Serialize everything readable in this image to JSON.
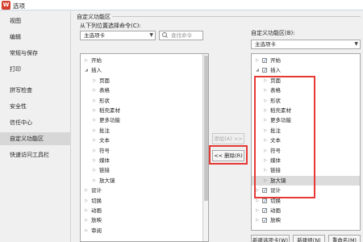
{
  "window": {
    "title": "选项",
    "logo_text": "W"
  },
  "sidebar": {
    "items": [
      {
        "label": "视图"
      },
      {
        "label": "编辑"
      },
      {
        "label": "常规与保存"
      },
      {
        "label": "打印"
      },
      {
        "label": "拼写检查"
      },
      {
        "label": "安全性"
      },
      {
        "label": "信任中心"
      },
      {
        "label": "自定义功能区",
        "active": true
      },
      {
        "label": "快速访问工具栏"
      }
    ]
  },
  "main": {
    "section_title": "自定义功能区",
    "left": {
      "label": "从下列位置选择命令(C):",
      "dropdown": "主选项卡",
      "search_placeholder": "查找命令",
      "items": [
        {
          "label": "开始",
          "level": 0,
          "expanded": false
        },
        {
          "label": "插入",
          "level": 0,
          "expanded": true
        },
        {
          "label": "页面",
          "level": 1
        },
        {
          "label": "表格",
          "level": 1
        },
        {
          "label": "形状",
          "level": 1
        },
        {
          "label": "稻壳素材",
          "level": 1
        },
        {
          "label": "更多功能",
          "level": 1
        },
        {
          "label": "批注",
          "level": 1
        },
        {
          "label": "文本",
          "level": 1
        },
        {
          "label": "符号",
          "level": 1
        },
        {
          "label": "媒体",
          "level": 1
        },
        {
          "label": "链接",
          "level": 1
        },
        {
          "label": "放大镜",
          "level": 1
        },
        {
          "label": "设计",
          "level": 0,
          "expanded": false
        },
        {
          "label": "切换",
          "level": 0,
          "expanded": false
        },
        {
          "label": "动画",
          "level": 0,
          "expanded": false
        },
        {
          "label": "放映",
          "level": 0,
          "expanded": false
        },
        {
          "label": "审阅",
          "level": 0,
          "expanded": false
        }
      ]
    },
    "buttons": {
      "add": "添加(A) >>",
      "remove": "<< 删除(R)"
    },
    "right": {
      "label": "自定义功能区(B):",
      "dropdown": "主选项卡",
      "items": [
        {
          "label": "开始",
          "level": 0,
          "expanded": false,
          "checked": true
        },
        {
          "label": "插入",
          "level": 0,
          "expanded": true,
          "checked": true
        },
        {
          "label": "页面",
          "level": 1
        },
        {
          "label": "表格",
          "level": 1
        },
        {
          "label": "形状",
          "level": 1
        },
        {
          "label": "稻壳素材",
          "level": 1
        },
        {
          "label": "更多功能",
          "level": 1
        },
        {
          "label": "批注",
          "level": 1
        },
        {
          "label": "文本",
          "level": 1
        },
        {
          "label": "符号",
          "level": 1
        },
        {
          "label": "媒体",
          "level": 1
        },
        {
          "label": "链接",
          "level": 1
        },
        {
          "label": "放大镜",
          "level": 1,
          "selected": true
        },
        {
          "label": "设计",
          "level": 0,
          "expanded": false,
          "checked": true
        },
        {
          "label": "切换",
          "level": 0,
          "expanded": false,
          "checked": true
        },
        {
          "label": "动画",
          "level": 0,
          "expanded": false,
          "checked": true
        },
        {
          "label": "放映",
          "level": 0,
          "expanded": false,
          "checked": true
        }
      ],
      "bottom_buttons": [
        {
          "label": "新建选项卡(W)"
        },
        {
          "label": "新建组(N)"
        },
        {
          "label": "重命名(M)"
        }
      ]
    }
  },
  "colors": {
    "highlight_red": "#e53935",
    "sidebar_active": "#d7d7d7",
    "brand": "#d43f2e"
  }
}
